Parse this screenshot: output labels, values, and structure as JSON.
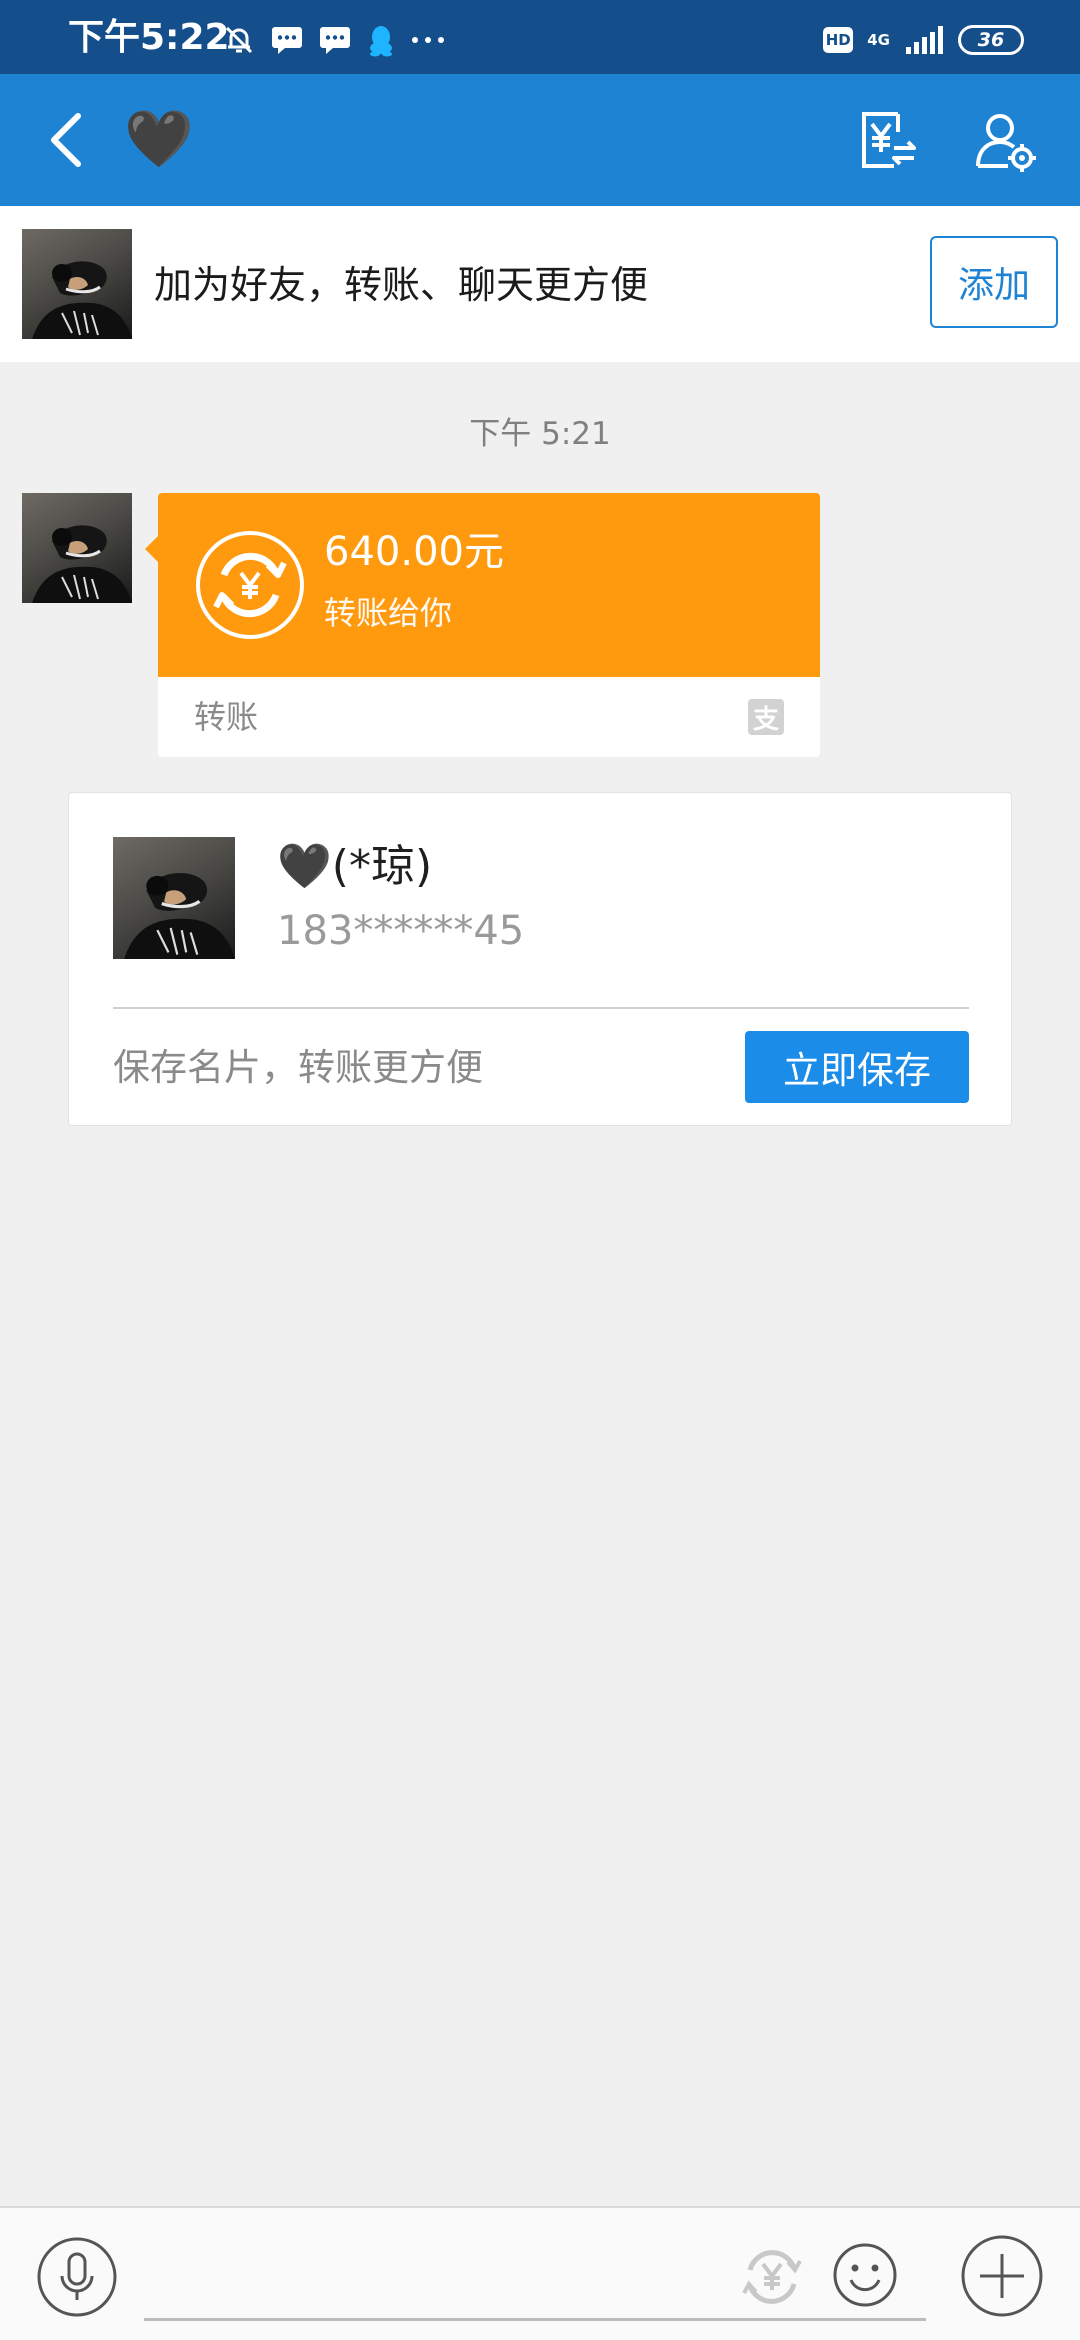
{
  "status_bar": {
    "time": "下午5:22",
    "network": "4G",
    "hd": "HD",
    "battery": "36"
  },
  "header": {
    "title": "🖤",
    "icons": [
      "back-icon",
      "yuan-transfer-icon",
      "user-settings-icon"
    ]
  },
  "banner": {
    "text": "加为好友，转账、聊天更方便",
    "add_label": "添加"
  },
  "messages": {
    "time_label": "下午 5:21",
    "transfer": {
      "amount": "640.00元",
      "description": "转账给你",
      "type_label": "转账",
      "accent": "#ff9a0f"
    }
  },
  "contact_card": {
    "name": "🖤(*琼)",
    "phone": "183******45",
    "hint": "保存名片，转账更方便",
    "save_label": "立即保存",
    "accent": "#1b8ce8"
  },
  "input_bar": {
    "icons": [
      "microphone-icon",
      "yuan-icon",
      "emoji-icon",
      "plus-icon"
    ]
  },
  "colors": {
    "header_bg": "#1f83d4",
    "status_bg": "#154f8b",
    "page_bg": "#f0f0f0"
  }
}
